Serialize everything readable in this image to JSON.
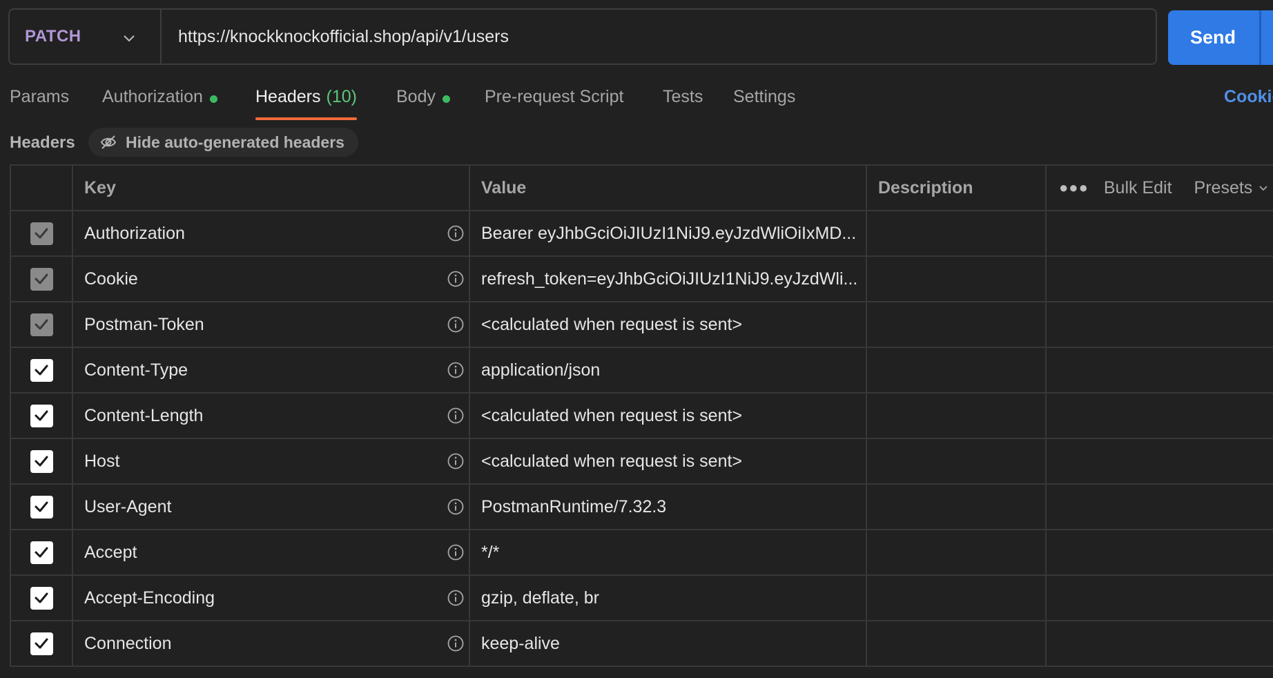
{
  "request": {
    "method": "PATCH",
    "url": "https://knockknockofficial.shop/api/v1/users",
    "send_label": "Send"
  },
  "tabs": [
    {
      "label": "Params",
      "count": "",
      "dot": false,
      "active": false
    },
    {
      "label": "Authorization",
      "count": "",
      "dot": true,
      "active": false
    },
    {
      "label": "Headers",
      "count": "(10)",
      "dot": false,
      "active": true
    },
    {
      "label": "Body",
      "count": "",
      "dot": true,
      "active": false
    },
    {
      "label": "Pre-request Script",
      "count": "",
      "dot": false,
      "active": false
    },
    {
      "label": "Tests",
      "count": "",
      "dot": false,
      "active": false
    },
    {
      "label": "Settings",
      "count": "",
      "dot": false,
      "active": false
    }
  ],
  "cookies_label": "Cookie",
  "headers_section": {
    "title": "Headers",
    "hide_auto_label": "Hide auto-generated headers"
  },
  "table": {
    "columns": {
      "key": "Key",
      "value": "Value",
      "description": "Description"
    },
    "bulk_edit": "Bulk Edit",
    "presets": "Presets",
    "rows": [
      {
        "key": "Authorization",
        "value": "Bearer eyJhbGciOiJIUzI1NiJ9.eyJzdWliOiIxMD...",
        "checked": "locked"
      },
      {
        "key": "Cookie",
        "value": "refresh_token=eyJhbGciOiJIUzI1NiJ9.eyJzdWli...",
        "checked": "locked"
      },
      {
        "key": "Postman-Token",
        "value": "<calculated when request is sent>",
        "checked": "locked"
      },
      {
        "key": "Content-Type",
        "value": "application/json",
        "checked": "on"
      },
      {
        "key": "Content-Length",
        "value": "<calculated when request is sent>",
        "checked": "on"
      },
      {
        "key": "Host",
        "value": "<calculated when request is sent>",
        "checked": "on"
      },
      {
        "key": "User-Agent",
        "value": "PostmanRuntime/7.32.3",
        "checked": "on"
      },
      {
        "key": "Accept",
        "value": "*/*",
        "checked": "on"
      },
      {
        "key": "Accept-Encoding",
        "value": "gzip, deflate, br",
        "checked": "on"
      },
      {
        "key": "Connection",
        "value": "keep-alive",
        "checked": "on"
      }
    ]
  },
  "colors": {
    "background": "#212121",
    "method": "#b197d6",
    "send": "#2f7ae5",
    "active_tab_underline": "#f26b3a",
    "dot_green": "#3cba62",
    "link_blue": "#4f8fe8"
  }
}
